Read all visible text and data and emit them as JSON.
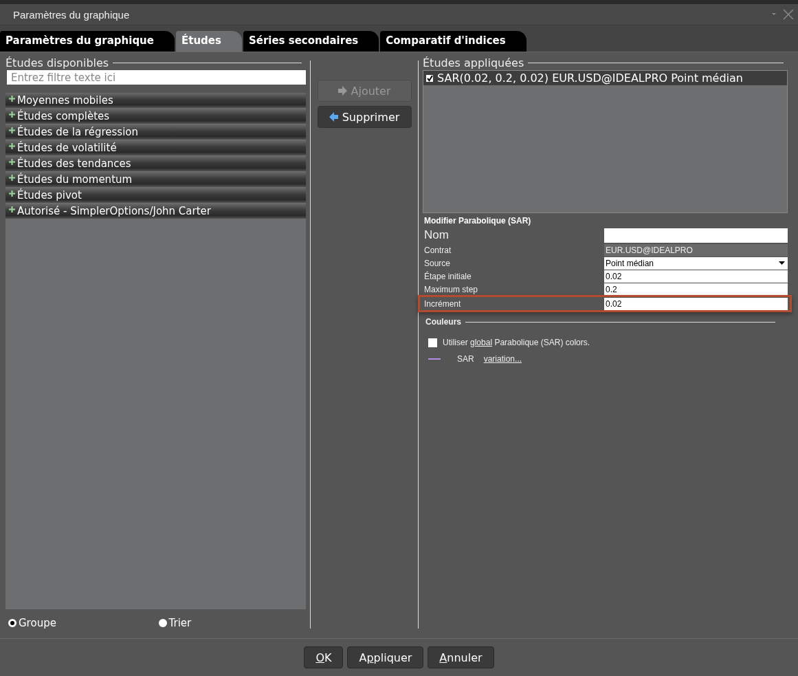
{
  "window": {
    "title": "Paramètres du graphique"
  },
  "tabs": [
    {
      "label": "Paramètres du graphique",
      "selected": false
    },
    {
      "label": "Études",
      "selected": true
    },
    {
      "label": "Séries secondaires",
      "selected": false
    },
    {
      "label": "Comparatif d'indices",
      "selected": false
    }
  ],
  "available": {
    "title": "Études disponibles",
    "filter_placeholder": "Entrez filtre texte ici",
    "groups": [
      {
        "label": "Moyennes mobiles",
        "expanded": false
      },
      {
        "label": "Études complètes",
        "expanded": false
      },
      {
        "label": "Études de la régression",
        "expanded": false
      },
      {
        "label": "Études de volatilité",
        "expanded": false
      },
      {
        "label": "Études des tendances",
        "expanded": false
      },
      {
        "label": "Études du momentum",
        "expanded": false
      },
      {
        "label": "Études pivot",
        "expanded": false
      },
      {
        "label": "Autorisé - SimplerOptions/John Carter",
        "expanded": false
      }
    ],
    "view_options": [
      {
        "label": "Groupe",
        "selected": true
      },
      {
        "label": "Trier",
        "selected": false
      }
    ]
  },
  "actions": [
    {
      "label": "Ajouter",
      "kind": "add",
      "disabled": true
    },
    {
      "label": "Supprimer",
      "kind": "remove",
      "disabled": false
    }
  ],
  "applied": {
    "title": "Études appliquées",
    "items": [
      {
        "label": "SAR(0.02, 0.2, 0.02) EUR.USD@IDEALPRO Point médian",
        "checked": true,
        "selected": true
      }
    ]
  },
  "editor": {
    "title": "Modifier Parabolique (SAR)",
    "fields": [
      {
        "label": "Nom",
        "kind": "text",
        "large": true
      },
      {
        "label": "Contrat",
        "kind": "readonly",
        "value": "EUR.USD@IDEALPRO"
      },
      {
        "label": "Source",
        "kind": "select",
        "value": "Point médian"
      },
      {
        "label": "Étape initiale",
        "kind": "text",
        "value": "0.02"
      },
      {
        "label": "Maximum step",
        "kind": "text",
        "value": "0.2"
      },
      {
        "label": "Incrément",
        "kind": "text",
        "value": "0.02",
        "highlighted": true
      }
    ],
    "colors": {
      "title": "Couleurs",
      "use_global": {
        "checked": false,
        "before": "Utiliser",
        "link": "global",
        "after": "Parabolique (SAR) colors."
      },
      "lines": [
        {
          "label": "SAR",
          "link": "variation...",
          "color": "#b48ce6"
        }
      ]
    }
  },
  "buttons": [
    {
      "label": "OK"
    },
    {
      "label": "Appliquer"
    },
    {
      "label": "Annuler"
    }
  ]
}
